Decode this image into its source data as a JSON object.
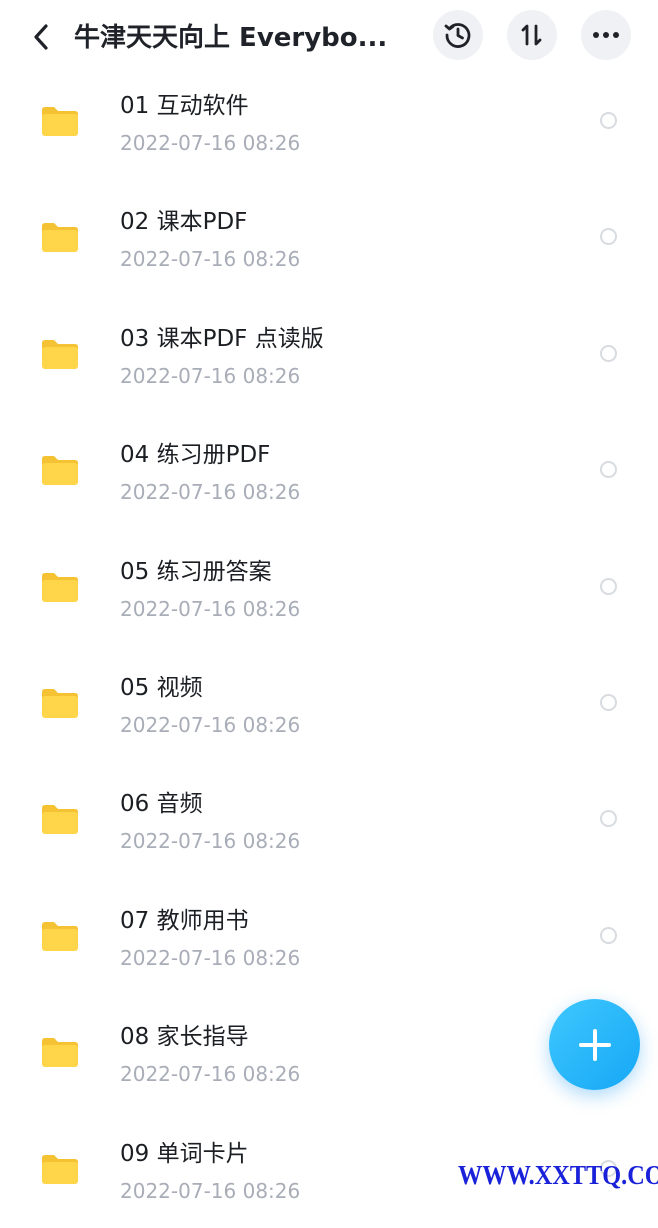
{
  "header": {
    "title": "牛津天天向上 Everybo...",
    "back_icon": "chevron-left-icon",
    "history_icon": "history-clock-icon",
    "sort_icon": "sort-arrows-icon",
    "more_icon": "more-dots-icon"
  },
  "files": [
    {
      "name": "01 互动软件",
      "date": "2022-07-16  08:26"
    },
    {
      "name": "02 课本PDF",
      "date": "2022-07-16  08:26"
    },
    {
      "name": "03 课本PDF 点读版",
      "date": "2022-07-16  08:26"
    },
    {
      "name": "04 练习册PDF",
      "date": "2022-07-16  08:26"
    },
    {
      "name": "05 练习册答案",
      "date": "2022-07-16  08:26"
    },
    {
      "name": "05 视频",
      "date": "2022-07-16  08:26"
    },
    {
      "name": "06 音频",
      "date": "2022-07-16  08:26"
    },
    {
      "name": "07 教师用书",
      "date": "2022-07-16  08:26"
    },
    {
      "name": "08 家长指导",
      "date": "2022-07-16  08:26"
    },
    {
      "name": "09 单词卡片",
      "date": "2022-07-16  08:26"
    }
  ],
  "fab": {
    "icon": "plus-icon"
  },
  "watermark": {
    "text": "WWW.XXTTQ.COM"
  },
  "colors": {
    "folder": "#FFD54A",
    "folder_tab": "#F5C233",
    "accent": "#16A7F5",
    "watermark": "#1A22D9"
  }
}
